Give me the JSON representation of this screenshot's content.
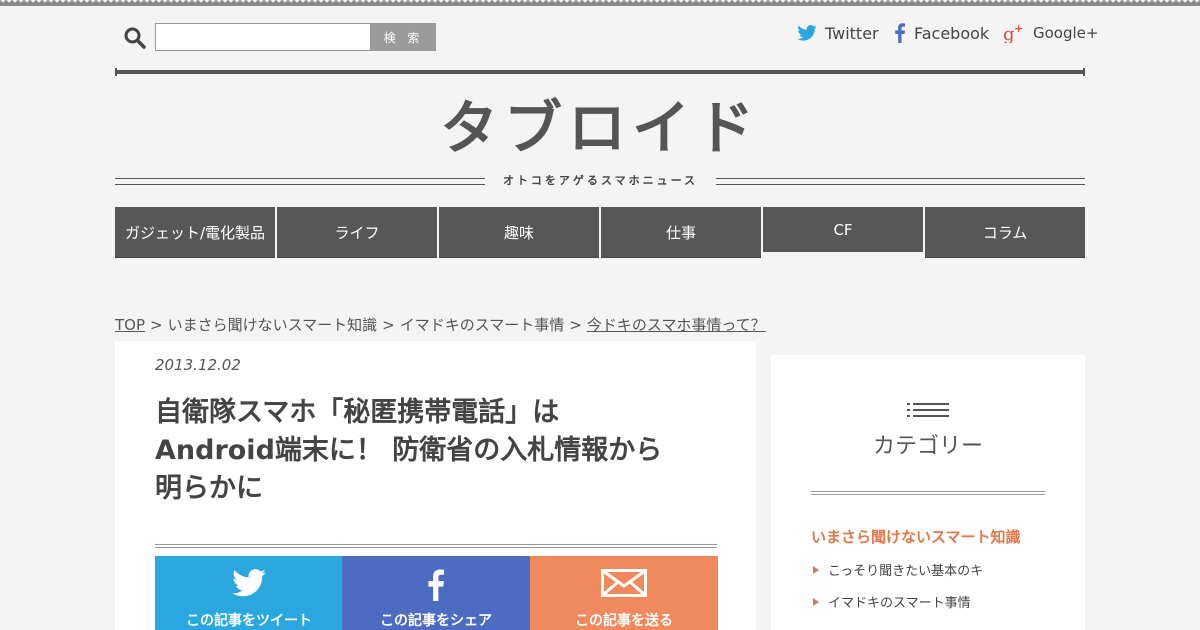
{
  "header": {
    "search_placeholder": "",
    "search_button": "検 索",
    "social": [
      {
        "name": "Twitter"
      },
      {
        "name": "Facebook"
      },
      {
        "name": "Google+"
      }
    ]
  },
  "site": {
    "logo_text": "タブロイド",
    "tagline": "オトコをアゲるスマホニュース"
  },
  "nav": [
    "ガジェット/電化製品",
    "ライフ",
    "趣味",
    "仕事",
    "CF",
    "コラム"
  ],
  "breadcrumb": {
    "top": "TOP",
    "items": [
      "いまさら聞けないスマート知識",
      "イマドキのスマート事情"
    ],
    "current": "今ドキのスマホ事情って？"
  },
  "article": {
    "date": "2013.12.02",
    "title_lines": [
      "自衛隊スマホ「秘匿携帯電話」は",
      "Android端末に！ 防衛省の入札情報から",
      "明らかに"
    ],
    "share": [
      "この記事をツイート",
      "この記事をシェア",
      "この記事を送る"
    ]
  },
  "sidebar": {
    "heading": "カテゴリー",
    "category": "いまさら聞けないスマート知識",
    "subitems": [
      "こっそり聞きたい基本のキ",
      "イマドキのスマート事情"
    ]
  },
  "colors": {
    "nav_bg": "#575757",
    "twitter": "#2ba7e0",
    "facebook": "#4c6cc1",
    "mail": "#f08a5d",
    "accent": "#e2774a"
  }
}
